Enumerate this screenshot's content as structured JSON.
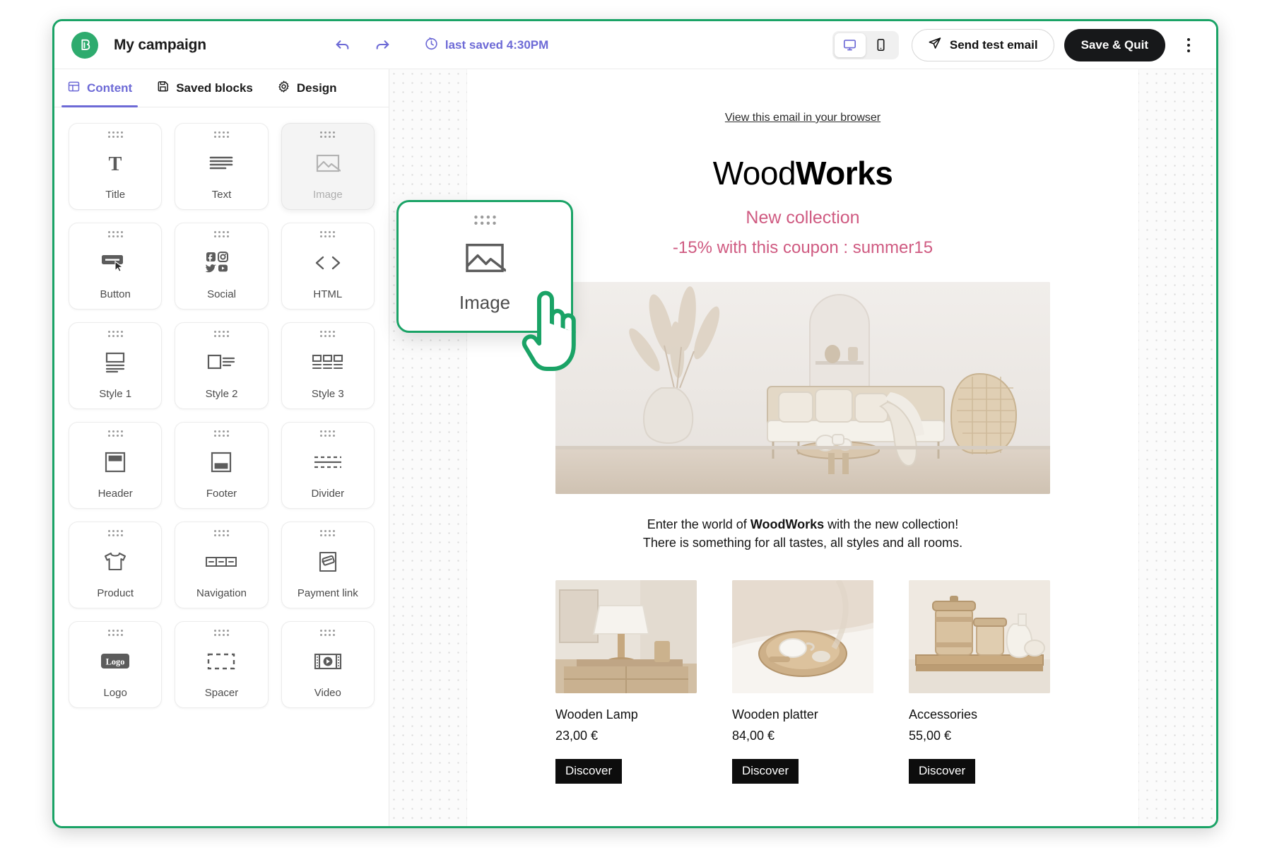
{
  "topbar": {
    "logo_icon": "brevo-b-logo-icon",
    "campaign_title": "My campaign",
    "undo_icon": "undo-arrow-icon",
    "redo_icon": "redo-arrow-icon",
    "saved_icon": "clock-history-icon",
    "saved_text": "last saved 4:30PM",
    "desktop_icon": "desktop-monitor-icon",
    "mobile_icon": "mobile-phone-icon",
    "send_test_icon": "paper-plane-icon",
    "send_test_label": "Send test email",
    "save_quit_label": "Save & Quit",
    "more_icon": "kebab-menu-icon",
    "accent_green": "#1aa366",
    "accent_purple": "#6d6ad6",
    "dark_button": "#17181a"
  },
  "tabs": [
    {
      "label": "Content",
      "icon": "layout-panel-icon",
      "active": true
    },
    {
      "label": "Saved blocks",
      "icon": "floppy-disk-icon",
      "active": false
    },
    {
      "label": "Design",
      "icon": "gear-icon",
      "active": false
    }
  ],
  "blocks": [
    {
      "label": "Title",
      "icon": "serif-t-icon",
      "state": "normal"
    },
    {
      "label": "Text",
      "icon": "text-lines-icon",
      "state": "normal"
    },
    {
      "label": "Image",
      "icon": "picture-icon",
      "state": "ghost"
    },
    {
      "label": "Button",
      "icon": "button-pointer-icon",
      "state": "normal"
    },
    {
      "label": "Social",
      "icon": "social-networks-icon",
      "state": "normal"
    },
    {
      "label": "HTML",
      "icon": "code-brackets-icon",
      "state": "normal"
    },
    {
      "label": "Style 1",
      "icon": "style-one-image-over-text-icon",
      "state": "normal"
    },
    {
      "label": "Style 2",
      "icon": "style-two-image-beside-text-icon",
      "state": "normal"
    },
    {
      "label": "Style 3",
      "icon": "style-three-columns-icon",
      "state": "normal"
    },
    {
      "label": "Header",
      "icon": "header-bar-icon",
      "state": "normal"
    },
    {
      "label": "Footer",
      "icon": "footer-bar-icon",
      "state": "normal"
    },
    {
      "label": "Divider",
      "icon": "divider-lines-icon",
      "state": "normal"
    },
    {
      "label": "Product",
      "icon": "tshirt-icon",
      "state": "normal"
    },
    {
      "label": "Navigation",
      "icon": "nav-segments-icon",
      "state": "normal"
    },
    {
      "label": "Payment link",
      "icon": "payment-card-icon",
      "state": "normal"
    },
    {
      "label": "Logo",
      "icon": "logo-badge-icon",
      "state": "normal"
    },
    {
      "label": "Spacer",
      "icon": "dashed-rectangle-icon",
      "state": "normal"
    },
    {
      "label": "Video",
      "icon": "video-film-play-icon",
      "state": "normal"
    }
  ],
  "drag_card": {
    "label": "Image",
    "icon": "picture-icon",
    "grip_icon": "drag-grip-icon",
    "cursor_icon": "pointing-hand-cursor-icon",
    "outline_color": "#1aa366"
  },
  "email": {
    "view_in_browser": "View this email in your browser",
    "brand_light": "Wood",
    "brand_bold": "Works",
    "promo_1": "New collection",
    "promo_2": "-15% with this coupon : summer15",
    "promo_color": "#cf5a81",
    "hero_alt": "living-room-hero-image",
    "intro_before": "Enter the world of ",
    "intro_brand": "WoodWorks",
    "intro_after": " with the new collection!",
    "intro_line2": "There is something for all tastes, all styles and all rooms.",
    "products": [
      {
        "name": "Wooden Lamp",
        "price": "23,00 €",
        "button": "Discover",
        "thumb": "wooden-lamp-photo"
      },
      {
        "name": "Wooden platter",
        "price": "84,00 €",
        "button": "Discover",
        "thumb": "wooden-platter-photo"
      },
      {
        "name": "Accessories",
        "price": "55,00 €",
        "button": "Discover",
        "thumb": "accessories-photo"
      }
    ]
  }
}
